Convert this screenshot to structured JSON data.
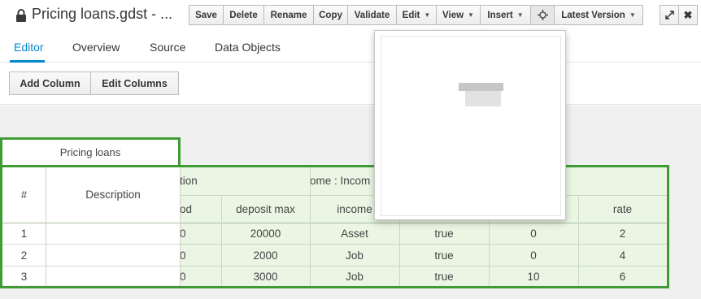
{
  "title": "Pricing loans.gdst - ...",
  "toolbar": {
    "save": "Save",
    "delete": "Delete",
    "rename": "Rename",
    "copy": "Copy",
    "validate": "Validate",
    "edit": "Edit",
    "view": "View",
    "insert": "Insert",
    "latest_version": "Latest Version"
  },
  "tabs": [
    "Editor",
    "Overview",
    "Source",
    "Data Objects"
  ],
  "actions": {
    "add_column": "Add Column",
    "edit_columns": "Edit Columns"
  },
  "table": {
    "name": "Pricing loans",
    "headers": {
      "row_number": "#",
      "description": "Description",
      "group_application": "tion",
      "group_income": "ome : Incom",
      "col_period": "od",
      "col_deposit_max": "deposit max",
      "col_income": "income",
      "col_rate": "rate"
    },
    "rows": [
      {
        "num": "1",
        "period": "0",
        "deposit_max": "20000",
        "income": "Asset",
        "flag": "true",
        "value": "0",
        "rate": "2"
      },
      {
        "num": "2",
        "period": "0",
        "deposit_max": "2000",
        "income": "Job",
        "flag": "true",
        "value": "0",
        "rate": "4"
      },
      {
        "num": "3",
        "period": "0",
        "deposit_max": "3000",
        "income": "Job",
        "flag": "true",
        "value": "10",
        "rate": "6"
      }
    ]
  },
  "colors": {
    "accent": "#0088ce",
    "selection_green": "#3f9c35",
    "cell_green": "#eaf6e3"
  }
}
